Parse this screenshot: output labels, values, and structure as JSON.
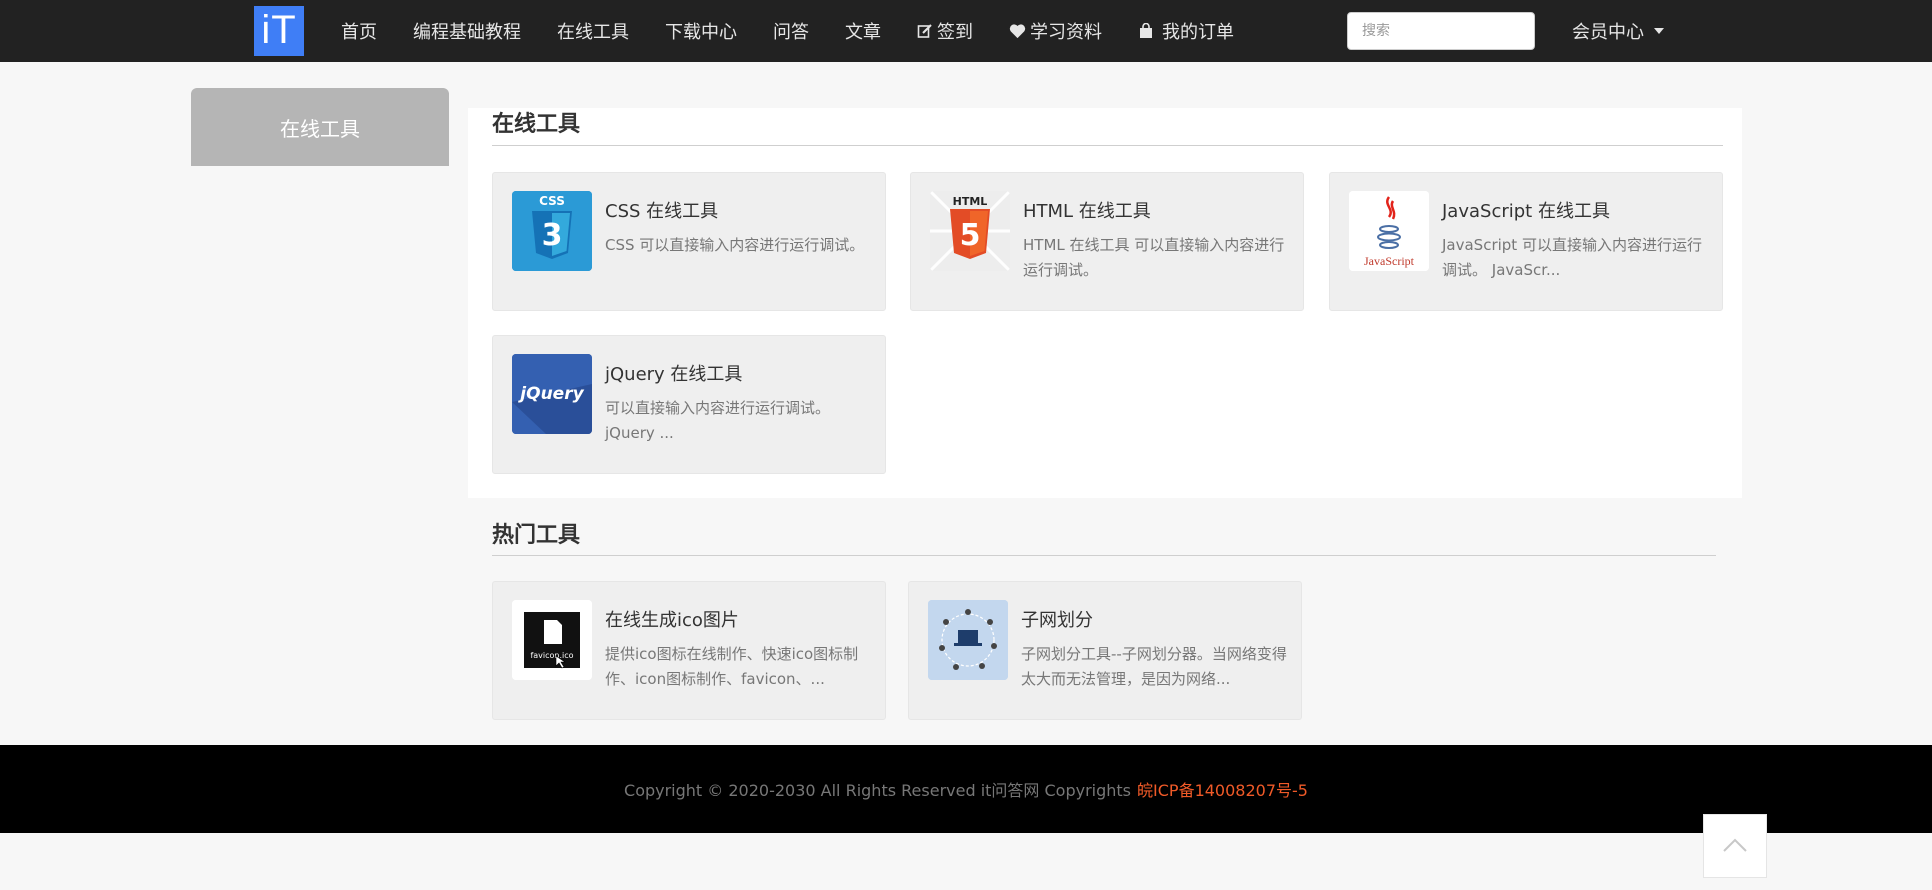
{
  "header": {
    "logo_text": "iT",
    "nav": [
      {
        "label": "首页"
      },
      {
        "label": "编程基础教程"
      },
      {
        "label": "在线工具"
      },
      {
        "label": "下载中心"
      },
      {
        "label": "问答"
      },
      {
        "label": "文章"
      },
      {
        "label": "签到",
        "icon": "edit-icon"
      },
      {
        "label": "学习资料",
        "icon": "heart-icon"
      },
      {
        "label": "我的订单",
        "icon": "shopping-bag-icon"
      }
    ],
    "search_placeholder": "搜索",
    "member_label": "会员中心"
  },
  "sidebar": {
    "active_tab": "在线工具"
  },
  "sections": {
    "online_tools": {
      "title": "在线工具",
      "cards": [
        {
          "title": "CSS 在线工具",
          "desc": "CSS 可以直接输入内容进行运行调试。",
          "icon": "css3-icon",
          "icon_text": "CSS",
          "big": "3"
        },
        {
          "title": "HTML 在线工具",
          "desc": "HTML 在线工具 可以直接输入内容进行运行调试。",
          "icon": "html5-icon",
          "icon_text": "HTML",
          "big": "5"
        },
        {
          "title": "JavaScript 在线工具",
          "desc": "JavaScript 可以直接输入内容进行运行调试。 JavaScr...",
          "icon": "javascript-icon",
          "icon_text": "JavaScript"
        },
        {
          "title": "jQuery 在线工具",
          "desc": "可以直接输入内容进行运行调试。 jQuery ...",
          "icon": "jquery-icon",
          "icon_text": "jQuery"
        }
      ]
    },
    "hot_tools": {
      "title": "热门工具",
      "cards": [
        {
          "title": "在线生成ico图片",
          "desc": "提供ico图标在线制作、快速ico图标制作、icon图标制作、favicon、...",
          "icon": "favicon-icon",
          "icon_text": "favicon.ico"
        },
        {
          "title": "子网划分",
          "desc": "子网划分工具--子网划分器。当网络变得太大而无法管理，是因为网络...",
          "icon": "network-icon"
        }
      ]
    }
  },
  "footer": {
    "copyright": "Copyright © 2020-2030 All Rights Reserved it问答网 Copyrights",
    "icp": "皖ICP备14008207号-5"
  },
  "colors": {
    "brand": "#3f7ef6",
    "topbar": "#222222",
    "icp": "#f05a28"
  }
}
